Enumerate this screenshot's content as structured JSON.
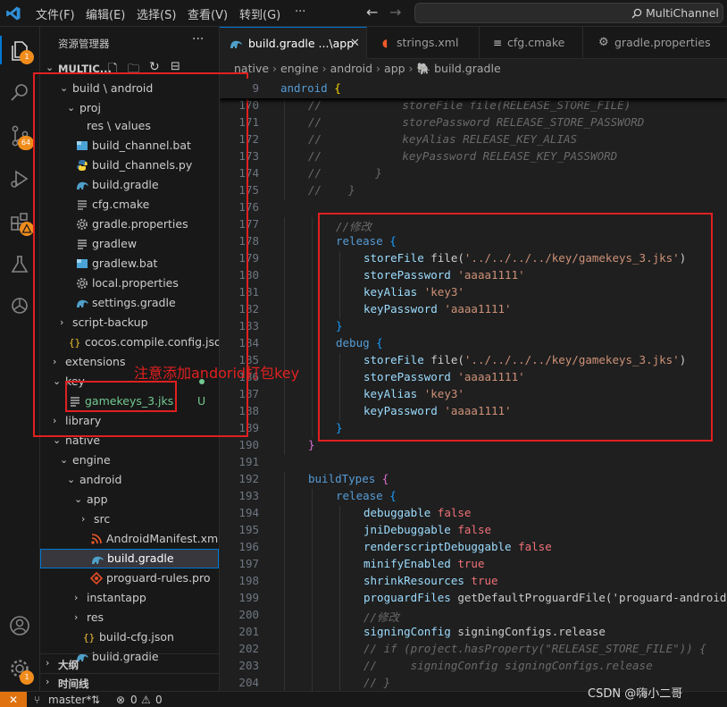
{
  "menu": [
    "文件(F)",
    "编辑(E)",
    "选择(S)",
    "查看(V)",
    "转到(G)",
    "···"
  ],
  "search": {
    "value": "MultiChannel"
  },
  "activity": {
    "explorer_badge": "1",
    "scm_badge": "64",
    "settings_badge": "1"
  },
  "sidebar": {
    "title": "资源管理器",
    "root": "MULTIC...",
    "rows": [
      {
        "label": "build \\ android",
        "chevron": "⌄",
        "icon": ""
      },
      {
        "label": "proj",
        "chevron": "⌄",
        "icon": ""
      },
      {
        "label": "res \\ values",
        "chevron": "",
        "icon": ""
      },
      {
        "label": "build_channel.bat",
        "chevron": "",
        "icon": "bat"
      },
      {
        "label": "build_channels.py",
        "chevron": "",
        "icon": "py"
      },
      {
        "label": "build.gradle",
        "chevron": "",
        "icon": "gradle"
      },
      {
        "label": "cfg.cmake",
        "chevron": "",
        "icon": "cmake"
      },
      {
        "label": "gradle.properties",
        "chevron": "",
        "icon": "gear"
      },
      {
        "label": "gradlew",
        "chevron": "",
        "icon": "file"
      },
      {
        "label": "gradlew.bat",
        "chevron": "",
        "icon": "bat"
      },
      {
        "label": "local.properties",
        "chevron": "",
        "icon": "gear"
      },
      {
        "label": "settings.gradle",
        "chevron": "",
        "icon": "gradle"
      },
      {
        "label": "script-backup",
        "chevron": "›",
        "icon": ""
      },
      {
        "label": "cocos.compile.config.json",
        "chevron": "",
        "icon": "json"
      },
      {
        "label": "extensions",
        "chevron": "›",
        "icon": ""
      },
      {
        "label": "key",
        "chevron": "⌄",
        "icon": ""
      },
      {
        "label": "gamekeys_3.jks",
        "chevron": "",
        "icon": "file",
        "status": "U"
      },
      {
        "label": "library",
        "chevron": "›",
        "icon": ""
      },
      {
        "label": "native",
        "chevron": "⌄",
        "icon": ""
      },
      {
        "label": "engine",
        "chevron": "⌄",
        "icon": ""
      },
      {
        "label": "android",
        "chevron": "⌄",
        "icon": ""
      },
      {
        "label": "app",
        "chevron": "⌄",
        "icon": ""
      },
      {
        "label": "src",
        "chevron": "›",
        "icon": ""
      },
      {
        "label": "AndroidManifest.xml",
        "chevron": "",
        "icon": "rss"
      },
      {
        "label": "build.gradle",
        "chevron": "",
        "icon": "gradle",
        "selected": true
      },
      {
        "label": "proguard-rules.pro",
        "chevron": "",
        "icon": "pro"
      },
      {
        "label": "instantapp",
        "chevron": "›",
        "icon": ""
      },
      {
        "label": "res",
        "chevron": "›",
        "icon": ""
      },
      {
        "label": "build-cfg.json",
        "chevron": "",
        "icon": "json"
      },
      {
        "label": "build.gradle",
        "chevron": "",
        "icon": "gradle"
      }
    ],
    "outline": "大纲",
    "timeline": "时间线"
  },
  "annotation": "注意添加andorid打包key",
  "tabs": [
    {
      "label": "build.gradle ...\\app",
      "active": true
    },
    {
      "label": "strings.xml",
      "active": false
    },
    {
      "label": "cfg.cmake",
      "active": false
    },
    {
      "label": "gradle.properties",
      "active": false
    }
  ],
  "breadcrumb": [
    "native",
    "engine",
    "android",
    "app",
    "build.gradle"
  ],
  "sticky": {
    "line": "9",
    "text": "android {"
  },
  "code": [
    {
      "n": "170",
      "t": "//            storeFile file(RELEASE_STORE_FILE)"
    },
    {
      "n": "171",
      "t": "//            storePassword RELEASE_STORE_PASSWORD"
    },
    {
      "n": "172",
      "t": "//            keyAlias RELEASE_KEY_ALIAS"
    },
    {
      "n": "173",
      "t": "//            keyPassword RELEASE_KEY_PASSWORD"
    },
    {
      "n": "174",
      "t": "//        }"
    },
    {
      "n": "175",
      "t": "//    }"
    },
    {
      "n": "176",
      "t": ""
    },
    {
      "n": "177",
      "t": "//修改"
    },
    {
      "n": "178",
      "t": "release {"
    },
    {
      "n": "179",
      "t": "storeFile file('../../../../key/gamekeys_3.jks')"
    },
    {
      "n": "180",
      "t": "storePassword 'aaaa1111'"
    },
    {
      "n": "181",
      "t": "keyAlias 'key3'"
    },
    {
      "n": "182",
      "t": "keyPassword 'aaaa1111'"
    },
    {
      "n": "183",
      "t": "}"
    },
    {
      "n": "184",
      "t": "debug {"
    },
    {
      "n": "185",
      "t": "storeFile file('../../../../key/gamekeys_3.jks')"
    },
    {
      "n": "186",
      "t": "storePassword 'aaaa1111'"
    },
    {
      "n": "187",
      "t": "keyAlias 'key3'"
    },
    {
      "n": "188",
      "t": "keyPassword 'aaaa1111'"
    },
    {
      "n": "189",
      "t": "}"
    },
    {
      "n": "190",
      "t": "}"
    },
    {
      "n": "191",
      "t": ""
    },
    {
      "n": "192",
      "t": "buildTypes {"
    },
    {
      "n": "193",
      "t": "release {"
    },
    {
      "n": "194",
      "t": "debuggable false"
    },
    {
      "n": "195",
      "t": "jniDebuggable false"
    },
    {
      "n": "196",
      "t": "renderscriptDebuggable false"
    },
    {
      "n": "197",
      "t": "minifyEnabled true"
    },
    {
      "n": "198",
      "t": "shrinkResources true"
    },
    {
      "n": "199",
      "t": "proguardFiles getDefaultProguardFile('proguard-android"
    },
    {
      "n": "200",
      "t": "//修改"
    },
    {
      "n": "201",
      "t": "signingConfig signingConfigs.release"
    },
    {
      "n": "202",
      "t": "// if (project.hasProperty(\"RELEASE_STORE_FILE\")) {"
    },
    {
      "n": "203",
      "t": "//     signingConfig signingConfigs.release"
    },
    {
      "n": "204",
      "t": "// }"
    }
  ],
  "status": {
    "branch": "master*",
    "errors": "0",
    "warnings": "0",
    "watermark": "CSDN @嗨小二哥"
  }
}
